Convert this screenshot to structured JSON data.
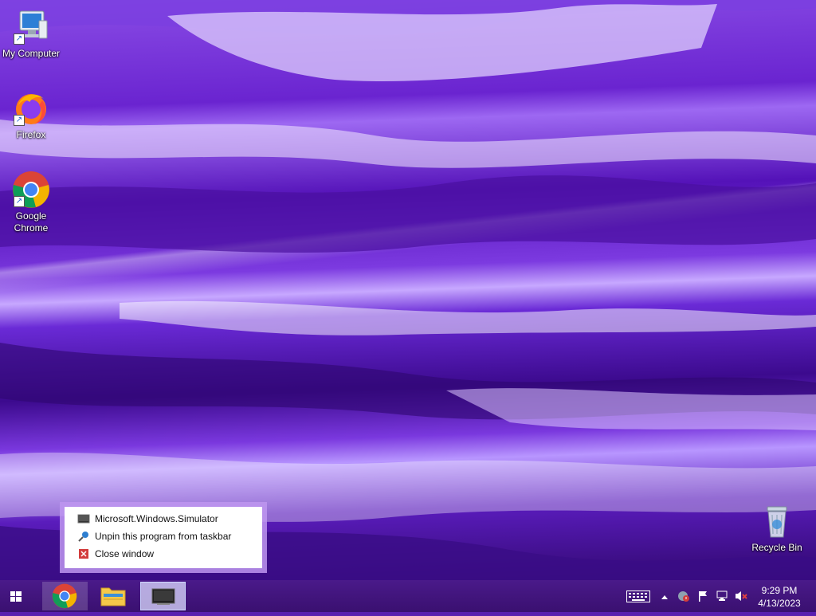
{
  "desktop": {
    "icons": [
      {
        "label": "My Computer",
        "icon": "computer-icon"
      },
      {
        "label": "Firefox",
        "icon": "firefox-icon"
      },
      {
        "label": "Google\nChrome",
        "icon": "chrome-icon"
      },
      {
        "label": "Recycle Bin",
        "icon": "recycle-bin-icon"
      }
    ]
  },
  "jumplist": {
    "title": "Microsoft.Windows.Simulator",
    "unpin": "Unpin this program from taskbar",
    "close": "Close window"
  },
  "taskbar": {
    "start_icon": "windows-logo-icon",
    "buttons": [
      {
        "name": "chrome-taskbar-button",
        "icon": "chrome-icon"
      },
      {
        "name": "file-explorer-taskbar-button",
        "icon": "folder-icon"
      },
      {
        "name": "simulator-taskbar-button",
        "icon": "monitor-icon"
      }
    ]
  },
  "tray": {
    "time": "9:29 PM",
    "date": "4/13/2023"
  },
  "colors": {
    "taskbar": "#3a1070",
    "accent": "#9d68f2"
  }
}
